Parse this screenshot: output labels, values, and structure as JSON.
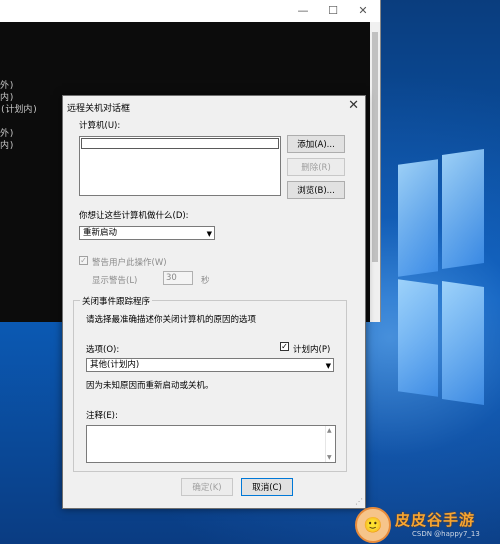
{
  "console": {
    "lines": [
      "外)",
      "内)",
      "(计划内)",
      "",
      "外)",
      "内)"
    ],
    "minimize_icon": "minimize-icon",
    "maximize_icon": "maximize-icon",
    "close_icon": "close-icon"
  },
  "dialog": {
    "title": "远程关机对话框",
    "close": "✕",
    "computers_label": "计算机(U):",
    "add_button": "添加(A)...",
    "remove_button": "删除(R)",
    "browse_button": "浏览(B)...",
    "action_label": "你想让这些计算机做什么(D):",
    "action_value": "重新启动",
    "warn_users_label": "警告用户此操作(W)",
    "display_warning_label": "显示警告(L)",
    "warning_seconds": "30",
    "seconds_unit": "秒",
    "tracker": {
      "title": "关闭事件跟踪程序",
      "description": "请选择最准确描述你关闭计算机的原因的选项",
      "option_label": "选项(O):",
      "planned_label": "计划内(P)",
      "planned_checked": true,
      "option_value": "其他(计划内)",
      "reason_text": "因为未知原因而重新启动或关机。",
      "comment_label": "注释(E):"
    },
    "ok_button": "确定(K)",
    "cancel_button": "取消(C)"
  },
  "watermark": {
    "badge": "🙂",
    "text": "皮皮谷手游",
    "csdn": "CSDN @happy7_13"
  }
}
